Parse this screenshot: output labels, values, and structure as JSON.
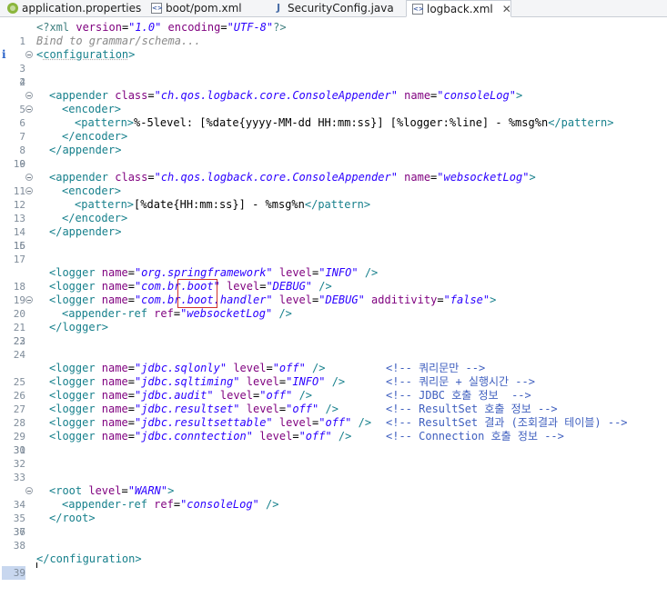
{
  "tabs": [
    {
      "label": "application.properties",
      "icon": "properties-file-icon"
    },
    {
      "label": "boot/pom.xml",
      "icon": "xml-file-icon"
    },
    {
      "label": "SecurityConfig.java",
      "icon": "java-file-icon"
    },
    {
      "label": "logback.xml",
      "icon": "xml-file-icon",
      "active": true
    }
  ],
  "editor": {
    "hint": "Bind to grammar/schema...",
    "line_numbers": [
      "1",
      "2",
      "3",
      "4",
      "5",
      "6",
      "7",
      "8",
      "9",
      "10",
      "11",
      "12",
      "13",
      "14",
      "15",
      "16",
      "17",
      "18",
      "19",
      "20",
      "21",
      "22",
      "23",
      "24",
      "25",
      "26",
      "27",
      "28",
      "29",
      "30",
      "31",
      "32",
      "33",
      "34",
      "35",
      "36",
      "37",
      "38",
      "39"
    ],
    "code": {
      "l1": {
        "a": "<?xml ",
        "b": "version",
        "c": "=",
        "d": "\"1.0\"",
        "e": " encoding",
        "f": "=",
        "g": "\"UTF-8\"",
        "h": "?>"
      },
      "l2": {
        "a": "<",
        "b": "configuration",
        "c": ">"
      },
      "l5": {
        "a": "<appender ",
        "b": "class",
        "c": "=",
        "d": "\"ch.qos.logback.core.ConsoleAppender\"",
        "e": " name",
        "f": "=",
        "g": "\"consoleLog\"",
        "h": ">"
      },
      "l6": {
        "a": "<encoder>"
      },
      "l7": {
        "a": "<pattern>",
        "b": "%-5level: [%date{yyyy-MM-dd HH:mm:ss}] [%logger:%line] - %msg%n",
        "c": "</pattern>"
      },
      "l8": {
        "a": "</encoder>"
      },
      "l9": {
        "a": "</appender>"
      },
      "l11": {
        "a": "<appender ",
        "b": "class",
        "c": "=",
        "d": "\"ch.qos.logback.core.ConsoleAppender\"",
        "e": " name",
        "f": "=",
        "g": "\"websocketLog\"",
        "h": ">"
      },
      "l12": {
        "a": "<encoder>"
      },
      "l13": {
        "a": "<pattern>",
        "b": "[%date{HH:mm:ss}] - %msg%n",
        "c": "</pattern>"
      },
      "l14": {
        "a": "</encoder>"
      },
      "l15": {
        "a": "</appender>"
      },
      "l18": {
        "a": "<logger ",
        "b": "name",
        "c": "=",
        "d": "\"org.springframework\"",
        "e": " level",
        "f": "=",
        "g": "\"INFO\"",
        "h": " />"
      },
      "l19": {
        "a": "<logger ",
        "b": "name",
        "c": "=",
        "d": "\"com.br.boot\"",
        "e": " level",
        "f": "=",
        "g": "\"DEBUG\"",
        "h": " />"
      },
      "l20": {
        "a": "<logger ",
        "b": "name",
        "c": "=",
        "d": "\"com.br.boot.handler\"",
        "e": " level",
        "f": "=",
        "g": "\"DEBUG\"",
        "h": " additivity",
        "i": "=",
        "j": "\"false\"",
        "k": ">"
      },
      "l21": {
        "a": "<appender-ref ",
        "b": "ref",
        "c": "=",
        "d": "\"websocketLog\"",
        "e": " />"
      },
      "l22": {
        "a": "</logger>"
      },
      "l25": {
        "a": "<logger ",
        "b": "name",
        "c": "=",
        "d": "\"jdbc.sqlonly\"",
        "e": " level",
        "f": "=",
        "g": "\"off\"",
        "h": " />",
        "cm": "<!-- 쿼리문만 -->"
      },
      "l26": {
        "a": "<logger ",
        "b": "name",
        "c": "=",
        "d": "\"jdbc.sqltiming\"",
        "e": " level",
        "f": "=",
        "g": "\"INFO\"",
        "h": " />",
        "cm": "<!-- 쿼리문 + 실행시간 -->"
      },
      "l27": {
        "a": "<logger ",
        "b": "name",
        "c": "=",
        "d": "\"jdbc.audit\"",
        "e": " level",
        "f": "=",
        "g": "\"off\"",
        "h": " />",
        "cm": "<!-- JDBC 호출 정보  -->"
      },
      "l28": {
        "a": "<logger ",
        "b": "name",
        "c": "=",
        "d": "\"jdbc.resultset\"",
        "e": " level",
        "f": "=",
        "g": "\"off\"",
        "h": " />",
        "cm": "<!-- ResultSet 호출 정보 -->"
      },
      "l29": {
        "a": "<logger ",
        "b": "name",
        "c": "=",
        "d": "\"jdbc.resultsettable\"",
        "e": " level",
        "f": "=",
        "g": "\"off\"",
        "h": " />",
        "cm": "<!-- ResultSet 결과 (조회결과 테이블) -->"
      },
      "l30": {
        "a": "<logger ",
        "b": "name",
        "c": "=",
        "d": "\"jdbc.conntection\"",
        "e": " level",
        "f": "=",
        "g": "\"off\"",
        "h": " />",
        "cm": "<!-- Connection 호출 정보 -->"
      },
      "l34": {
        "a": "<root ",
        "b": "level",
        "c": "=",
        "d": "\"WARN\"",
        "e": ">"
      },
      "l35": {
        "a": "<appender-ref ",
        "b": "ref",
        "c": "=",
        "d": "\"consoleLog\"",
        "e": " />"
      },
      "l36": {
        "a": "</root>"
      },
      "l39": {
        "a": "</configuration>"
      }
    }
  },
  "colors": {
    "tag": "#17808c",
    "attribute": "#7f007f",
    "value": "#2a00ff",
    "comment": "#3f5fbf",
    "highlight_box": "#d0302a",
    "line_number": "#7f8c9a"
  }
}
